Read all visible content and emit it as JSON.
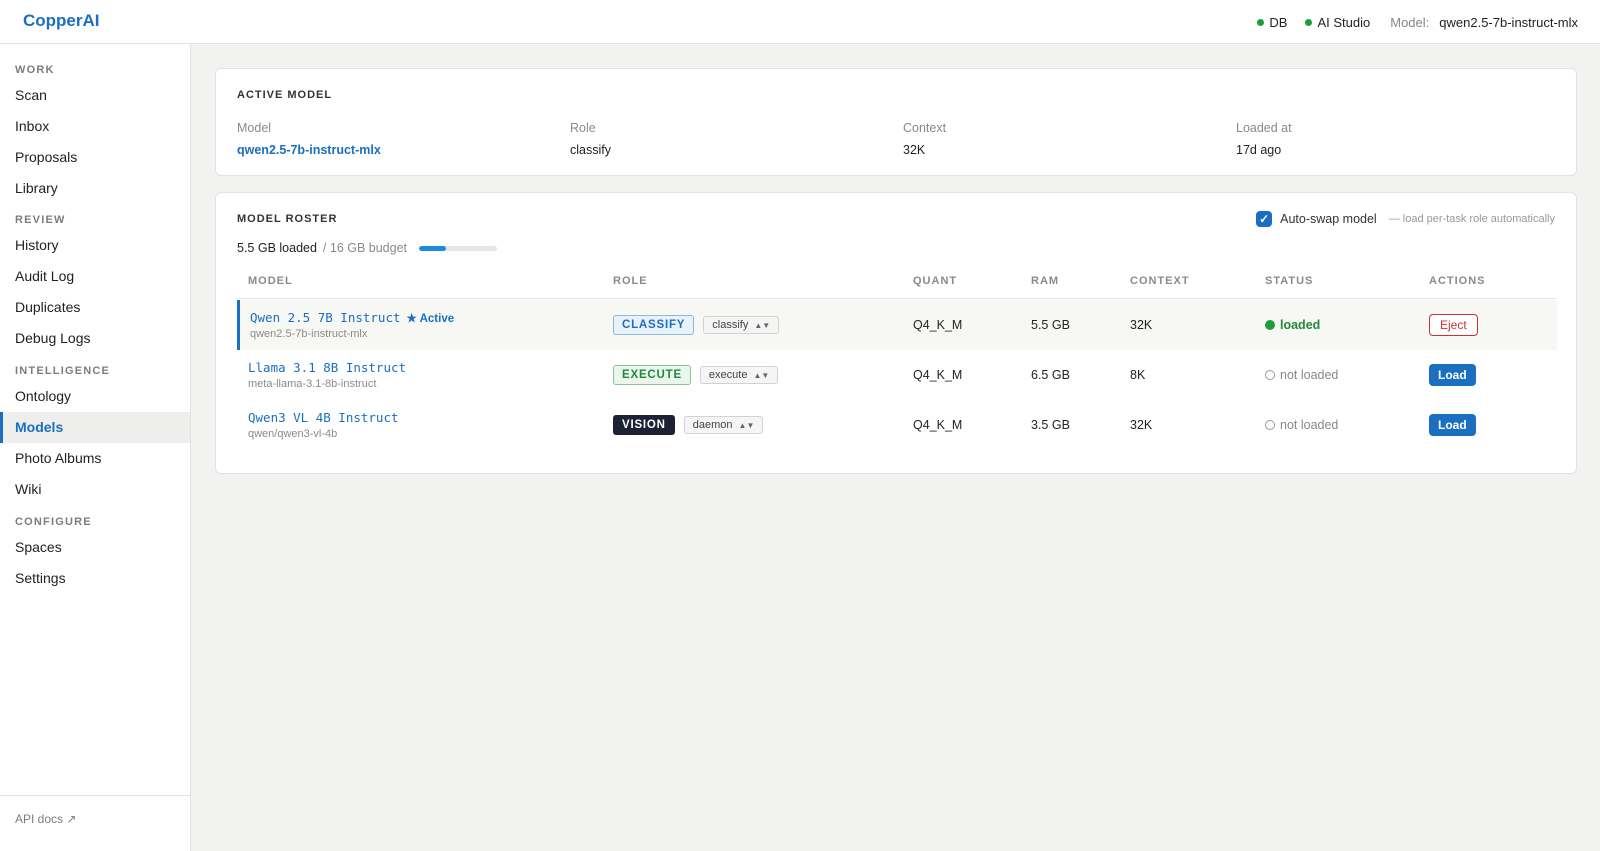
{
  "app": {
    "brand": "CopperAI"
  },
  "topbar": {
    "db_label": "DB",
    "studio_label": "AI Studio",
    "model_label": "Model:",
    "model_value": "qwen2.5-7b-instruct-mlx",
    "status_color": "#1f9d3a"
  },
  "sidebar": {
    "sections": [
      {
        "title": "WORK",
        "items": [
          "Scan",
          "Inbox",
          "Proposals",
          "Library"
        ]
      },
      {
        "title": "REVIEW",
        "items": [
          "History",
          "Audit Log",
          "Duplicates",
          "Debug Logs"
        ]
      },
      {
        "title": "INTELLIGENCE",
        "items": [
          "Ontology",
          "Models",
          "Photo Albums",
          "Wiki"
        ]
      },
      {
        "title": "CONFIGURE",
        "items": [
          "Spaces",
          "Settings"
        ]
      }
    ],
    "active_item": "Models",
    "footer_link": "API docs ↗"
  },
  "active_model": {
    "title": "ACTIVE MODEL",
    "fields": [
      {
        "label": "Model",
        "value": "qwen2.5-7b-instruct-mlx"
      },
      {
        "label": "Role",
        "value": "classify"
      },
      {
        "label": "Context",
        "value": "32K"
      },
      {
        "label": "Loaded at",
        "value": "17d ago"
      }
    ]
  },
  "roster": {
    "title": "MODEL ROSTER",
    "autoswap_label": "Auto-swap model",
    "autoswap_checked": true,
    "autoswap_hint": "— load per-task role automatically",
    "budget_loaded": "5.5 GB loaded",
    "budget_total": "/ 16 GB budget",
    "budget_fraction": 0.34,
    "columns": [
      "MODEL",
      "ROLE",
      "QUANT",
      "RAM",
      "CONTEXT",
      "STATUS",
      "ACTIONS"
    ],
    "rows": [
      {
        "name": "Qwen 2.5 7B Instruct",
        "active_tag": "★ Active",
        "id": "qwen2.5-7b-instruct-mlx",
        "role_badge": "CLASSIFY",
        "role_select": "classify",
        "quant": "Q4_K_M",
        "ram": "5.5 GB",
        "context": "32K",
        "status": "loaded",
        "action": "Eject"
      },
      {
        "name": "Llama 3.1 8B Instruct",
        "id": "meta-llama-3.1-8b-instruct",
        "role_badge": "EXECUTE",
        "role_select": "execute",
        "quant": "Q4_K_M",
        "ram": "6.5 GB",
        "context": "8K",
        "status": "not loaded",
        "action": "Load"
      },
      {
        "name": "Qwen3 VL 4B Instruct",
        "id": "qwen/qwen3-vl-4b",
        "role_badge": "VISION",
        "role_select": "daemon",
        "quant": "Q4_K_M",
        "ram": "3.5 GB",
        "context": "32K",
        "status": "not loaded",
        "action": "Load"
      }
    ]
  },
  "colors": {
    "accent": "#1a6fc0",
    "loaded_green": "#1f8a3a",
    "eject_red": "#c83232"
  }
}
